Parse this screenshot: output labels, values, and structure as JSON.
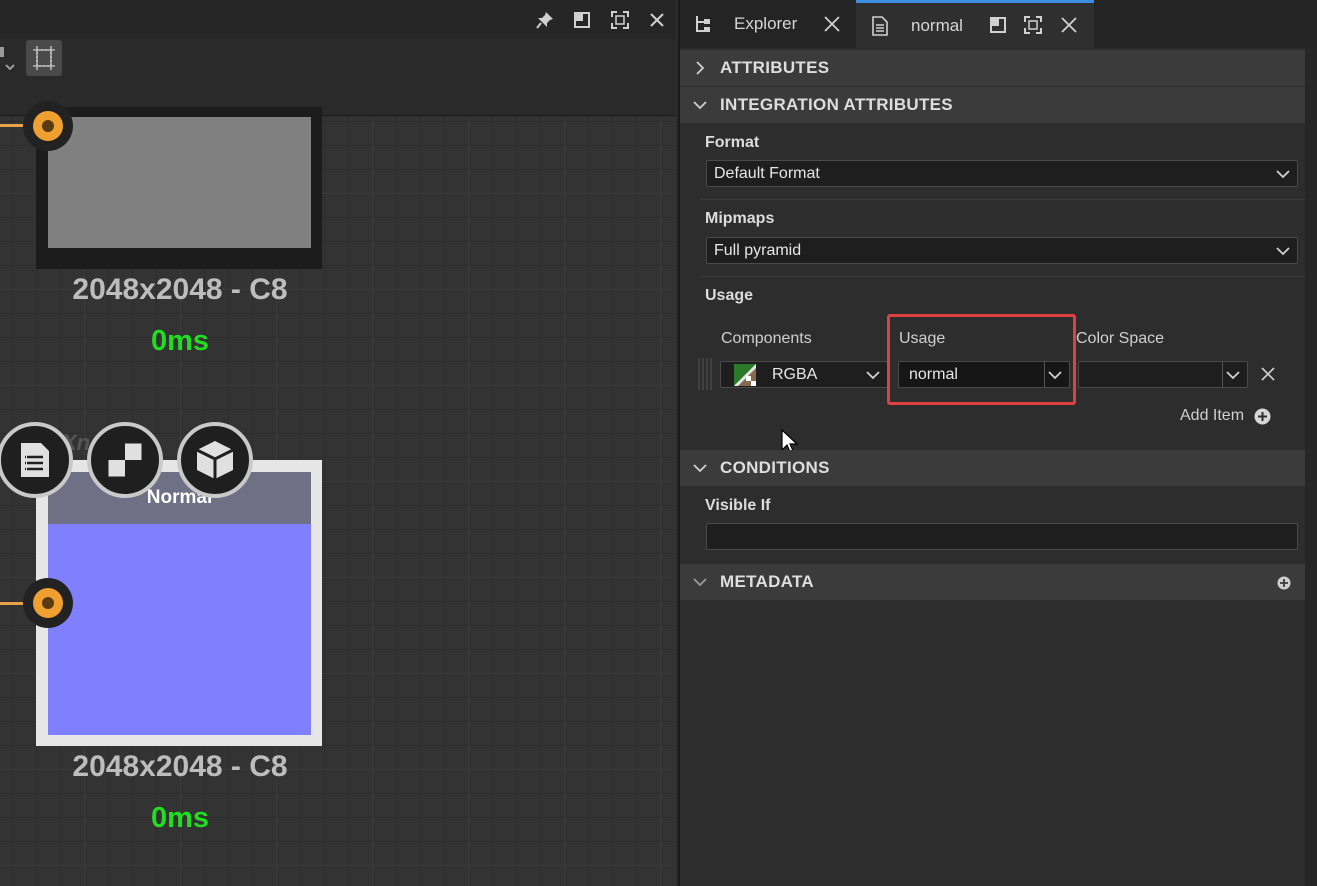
{
  "graph": {
    "nodes": [
      {
        "size_label": "2048x2048 - C8",
        "time_label": "0ms",
        "preview_color": "#808080"
      },
      {
        "title": "Normal",
        "size_label": "2048x2048 - C8",
        "time_label": "0ms",
        "preview_color": "#8080ff"
      }
    ]
  },
  "tabs": {
    "explorer_label": "Explorer",
    "normal_label": "normal"
  },
  "sections": {
    "attributes": "ATTRIBUTES",
    "integration": "INTEGRATION ATTRIBUTES",
    "conditions": "CONDITIONS",
    "metadata": "METADATA"
  },
  "format": {
    "label": "Format",
    "value": "Default Format"
  },
  "mipmaps": {
    "label": "Mipmaps",
    "value": "Full pyramid"
  },
  "usage_group": {
    "label": "Usage",
    "columns": {
      "components": "Components",
      "usage": "Usage",
      "color_space": "Color Space"
    },
    "row": {
      "components": "RGBA",
      "usage": "normal",
      "color_space": ""
    },
    "add_item": "Add Item"
  },
  "visible_if": {
    "label": "Visible If",
    "value": ""
  },
  "colors": {
    "accent": "#3d8ee0",
    "highlight": "#e04040",
    "time": "#22dd22",
    "port": "#f0a030"
  }
}
